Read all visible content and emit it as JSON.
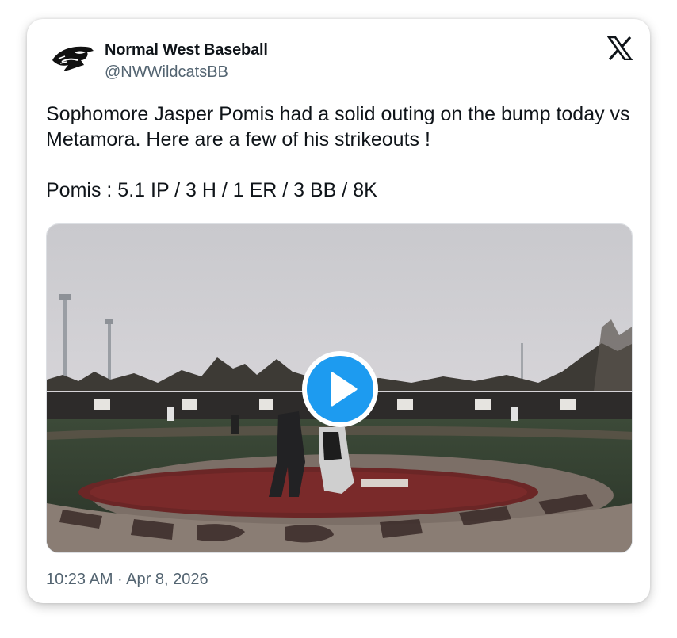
{
  "account": {
    "display_name": "Normal West Baseball",
    "handle": "@NWWildcatsBB",
    "avatar_icon": "wildcat-logo-icon"
  },
  "platform_icon": "x-logo-icon",
  "tweet": {
    "text": "Sophomore Jasper Pomis had a solid outing on the bump today vs Metamora. Here are a few of his strikeouts !\n\nPomis : 5.1 IP / 3 H / 1 ER / 3 BB / 8K"
  },
  "media": {
    "type": "video",
    "play_icon": "play-icon",
    "accent_color": "#1d9bf0"
  },
  "footer": {
    "timestamp": "10:23 AM · Apr 8, 2026"
  }
}
